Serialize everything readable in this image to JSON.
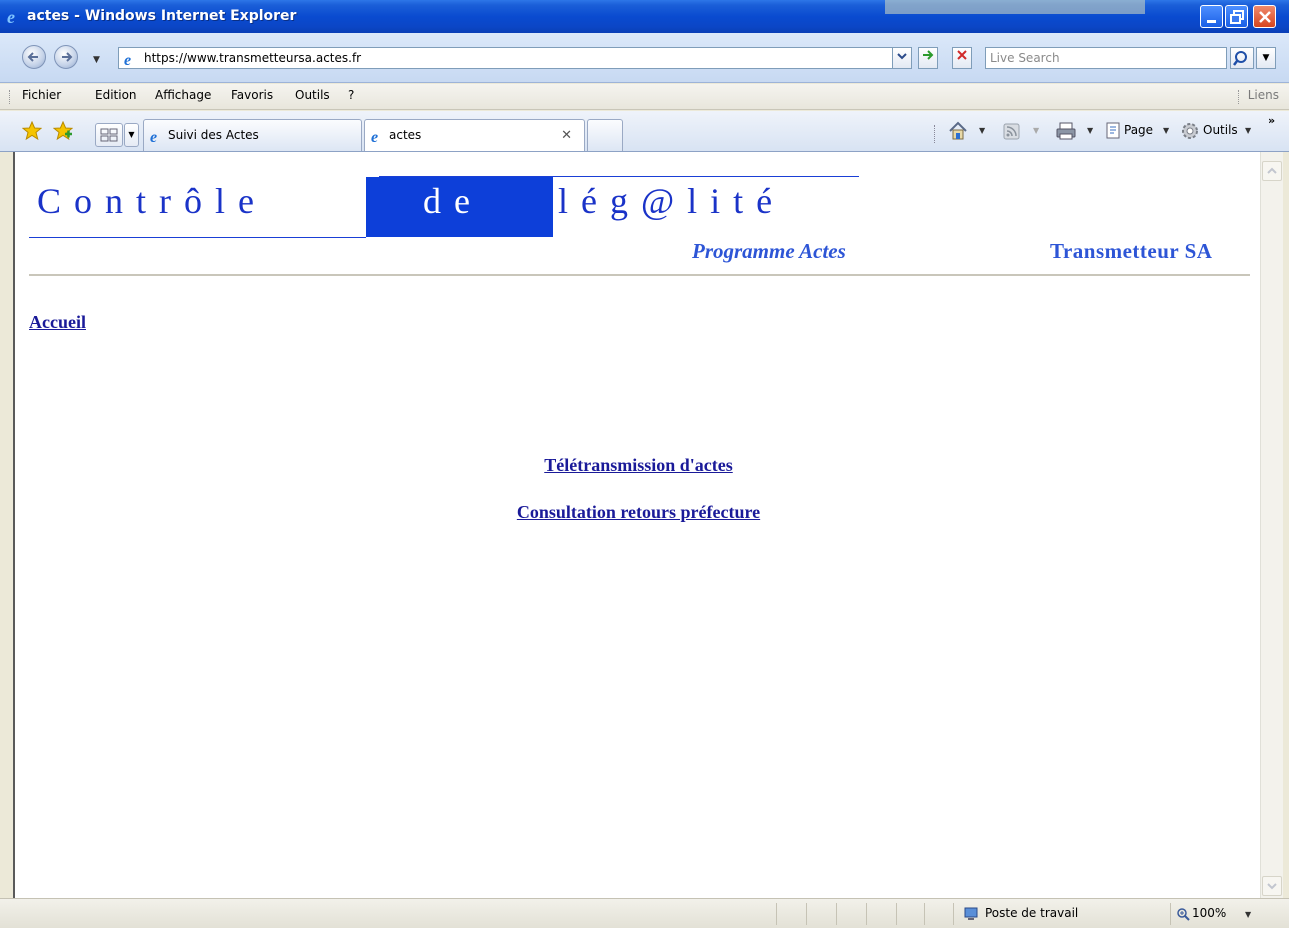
{
  "window": {
    "title": "actes - Windows Internet Explorer"
  },
  "address_bar": {
    "url": "https://www.transmetteursa.actes.fr",
    "search_placeholder": "Live Search"
  },
  "menu": {
    "items": [
      "Fichier",
      "Edition",
      "Affichage",
      "Favoris",
      "Outils",
      "?"
    ],
    "links_label": "Liens"
  },
  "tabs": [
    {
      "label": "Suivi des Actes",
      "active": false
    },
    {
      "label": "actes",
      "active": true
    }
  ],
  "command_bar": {
    "page_label": "Page",
    "tools_label": "Outils"
  },
  "page": {
    "banner": {
      "part1": "Contrôle",
      "part2": "de",
      "part3": "lég@lité"
    },
    "program": "Programme Actes",
    "company": "Transmetteur SA",
    "home_link": "Accueil",
    "links": [
      "Télétransmission d'actes",
      "Consultation retours préfecture"
    ]
  },
  "status_bar": {
    "zone": "Poste de travail",
    "zoom": "100%"
  },
  "colors": {
    "title_bar": "#0a4bd0",
    "banner_blue": "#0d3fd9",
    "banner_text": "#1a33c8",
    "link": "#1a1a99"
  }
}
